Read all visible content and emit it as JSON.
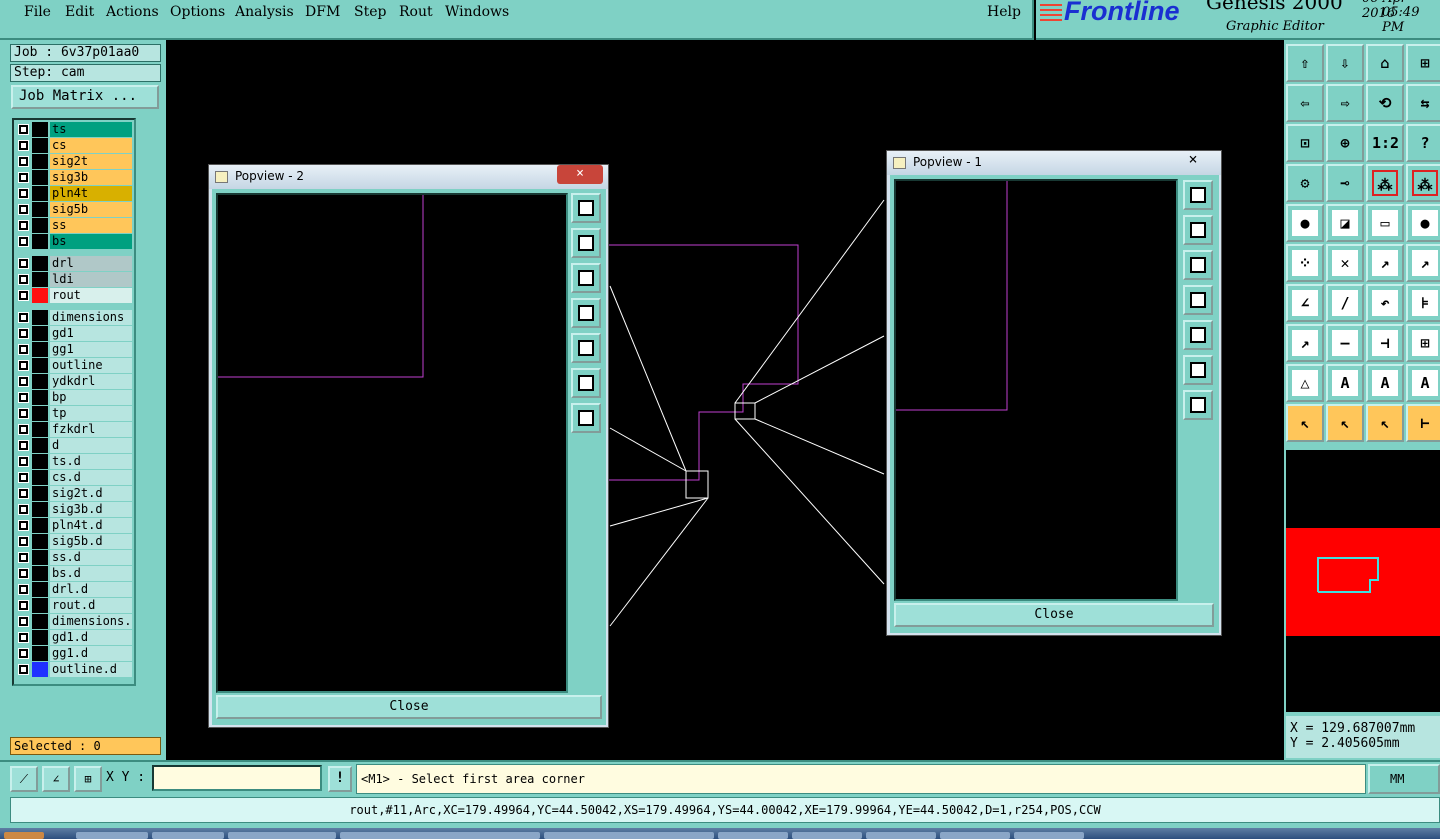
{
  "menu": {
    "items": [
      "File",
      "Edit",
      "Actions",
      "Options",
      "Analysis",
      "DFM",
      "Step",
      "Rout",
      "Windows"
    ],
    "help": "Help"
  },
  "brand": {
    "logo": "Frontline",
    "product": "Genesis 2000",
    "subtitle": "Graphic Editor",
    "date": "06-Apr-2016",
    "time": "05:49 PM"
  },
  "job": {
    "job_label": "Job : 6v37p01aa0",
    "step_label": "Step: cam",
    "matrix_button": "Job Matrix ...",
    "selected": "Selected : 0"
  },
  "layers": [
    {
      "name": "ts",
      "color": "#00a080"
    },
    {
      "name": "cs",
      "color": "#ffc65a"
    },
    {
      "name": "sig2t",
      "color": "#ffc65a"
    },
    {
      "name": "sig3b",
      "color": "#ffc65a"
    },
    {
      "name": "pln4t",
      "color": "#d8b000"
    },
    {
      "name": "sig5b",
      "color": "#ffc65a"
    },
    {
      "name": "ss",
      "color": "#ffc65a"
    },
    {
      "name": "bs",
      "color": "#00a080"
    },
    {
      "name": "drl",
      "color": "#b0c8c8"
    },
    {
      "name": "ldi",
      "color": "#b0c8c8"
    },
    {
      "name": "rout",
      "color": "#d8f0ec",
      "active": true
    },
    {
      "name": "dimensions",
      "color": "#b7e5e0"
    },
    {
      "name": "gd1",
      "color": "#b7e5e0"
    },
    {
      "name": "gg1",
      "color": "#b7e5e0"
    },
    {
      "name": "outline",
      "color": "#b7e5e0"
    },
    {
      "name": "ydkdrl",
      "color": "#b7e5e0"
    },
    {
      "name": "bp",
      "color": "#b7e5e0"
    },
    {
      "name": "tp",
      "color": "#b7e5e0"
    },
    {
      "name": "fzkdrl",
      "color": "#b7e5e0"
    },
    {
      "name": "d",
      "color": "#b7e5e0"
    },
    {
      "name": "ts.d",
      "color": "#b7e5e0"
    },
    {
      "name": "cs.d",
      "color": "#b7e5e0"
    },
    {
      "name": "sig2t.d",
      "color": "#b7e5e0"
    },
    {
      "name": "sig3b.d",
      "color": "#b7e5e0"
    },
    {
      "name": "pln4t.d",
      "color": "#b7e5e0"
    },
    {
      "name": "sig5b.d",
      "color": "#b7e5e0"
    },
    {
      "name": "ss.d",
      "color": "#b7e5e0"
    },
    {
      "name": "bs.d",
      "color": "#b7e5e0"
    },
    {
      "name": "drl.d",
      "color": "#b7e5e0"
    },
    {
      "name": "rout.d",
      "color": "#b7e5e0"
    },
    {
      "name": "dimensions.d",
      "color": "#b7e5e0"
    },
    {
      "name": "gd1.d",
      "color": "#b7e5e0"
    },
    {
      "name": "gg1.d",
      "color": "#b7e5e0"
    },
    {
      "name": "outline.d",
      "color": "#b7e5e0",
      "swatch": "#2030ff"
    }
  ],
  "popview2": {
    "title": "Popview - 2",
    "close": "Close",
    "close_x": "×"
  },
  "popview1": {
    "title": "Popview - 1",
    "close": "Close",
    "close_x": "×"
  },
  "toolbox": {
    "glyphs": [
      "⇧",
      "⇩",
      "⌂",
      "⊞",
      "⇦",
      "⇨",
      "⟲",
      "⇆",
      "⊡",
      "⊕",
      "1:2",
      "?",
      "⚙",
      "⊸",
      "⁂",
      "⁂",
      "●",
      "◪",
      "▭",
      "●",
      "⁘",
      "✕",
      "↗",
      "↗",
      "∠",
      "/",
      "↶",
      "⊧",
      "↗",
      "—",
      "⊣",
      "⊞",
      "△",
      "A",
      "A",
      "A",
      "↖",
      "↖",
      "↖",
      "⊢"
    ],
    "highlight_color": "#ffc65a"
  },
  "coords": {
    "x": "X = 129.687007mm",
    "y": "Y = 2.405605mm"
  },
  "command": {
    "xy_label": "X Y :",
    "xy_value": "",
    "bang": "!",
    "prompt": "<M1> - Select first area corner",
    "unit": "MM"
  },
  "status": "rout,#11,Arc,XC=179.49964,YC=44.50042,XS=179.49964,YS=44.00042,XE=179.99964,YE=44.50042,D=1,r254,POS,CCW"
}
